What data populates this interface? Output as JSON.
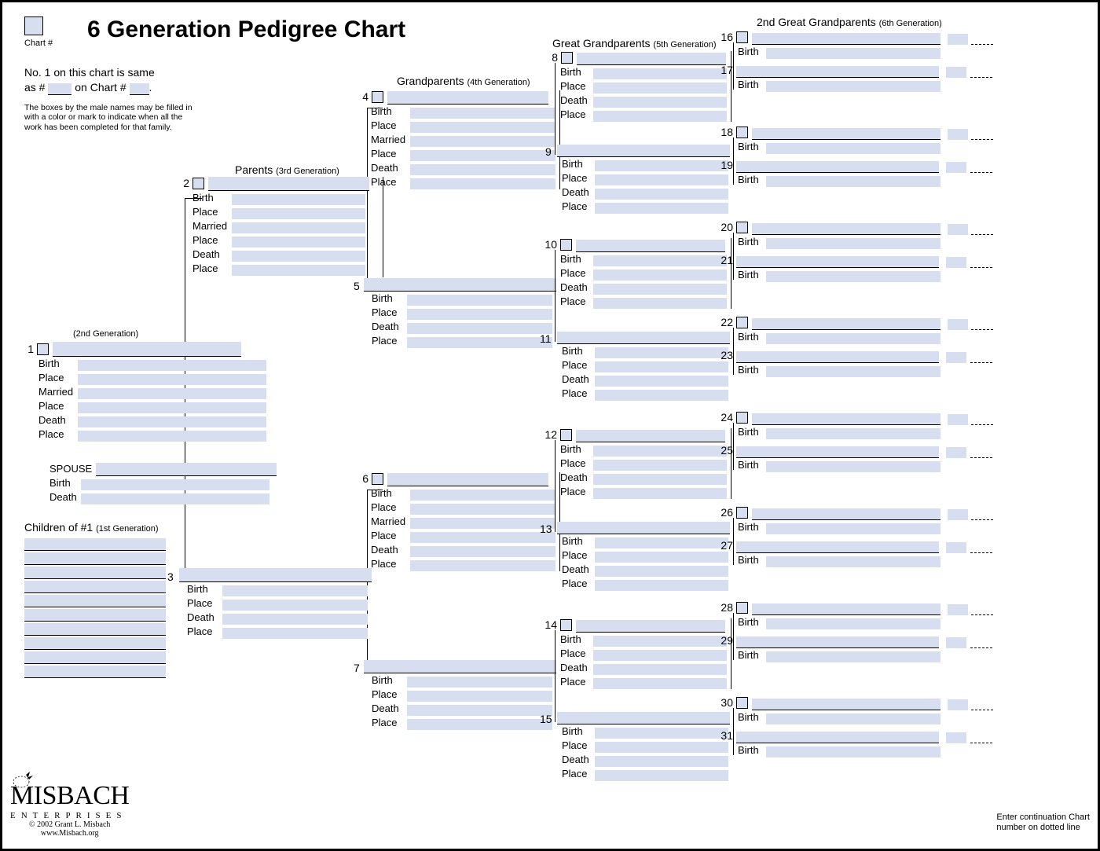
{
  "title": "6 Generation Pedigree Chart",
  "chartnum_label": "Chart #",
  "note_line1_a": "No. 1 on this chart is same",
  "note_line1_b": "as #",
  "note_line1_c": " on Chart #",
  "note_line1_d": ".",
  "note2": "The boxes by the male names may be filled in with a color or mark to indicate when all the work has been completed for that family.",
  "hdr_parents": "Parents",
  "hdr_parents_gen": "(3rd Generation)",
  "hdr_gp": "Grandparents",
  "hdr_gp_gen": "(4th Generation)",
  "hdr_ggp": "Great Grandparents",
  "hdr_ggp_gen": "(5th Generation)",
  "hdr_2ggp": "2nd Great Grandparents",
  "hdr_2ggp_gen": "(6th Generation)",
  "hdr_gen2": "(2nd Generation)",
  "hdr_spouse": "SPOUSE",
  "hdr_children_a": "Children of #1",
  "hdr_children_b": "(1st Generation)",
  "lbl_birth": "Birth",
  "lbl_place": "Place",
  "lbl_married": "Married",
  "lbl_death": "Death",
  "cont_note1": "Enter continuation Chart",
  "cont_note2": "number on dotted line",
  "logo_name": "MISBACH",
  "logo_ent": "ENTERPRISES",
  "copyright": "© 2002 Grant L. Misbach",
  "url": "www.Misbach.org",
  "n1": "1",
  "n2": "2",
  "n3": "3",
  "n4": "4",
  "n5": "5",
  "n6": "6",
  "n7": "7",
  "n8": "8",
  "n9": "9",
  "n10": "10",
  "n11": "11",
  "n12": "12",
  "n13": "13",
  "n14": "14",
  "n15": "15",
  "n16": "16",
  "n17": "17",
  "n18": "18",
  "n19": "19",
  "n20": "20",
  "n21": "21",
  "n22": "22",
  "n23": "23",
  "n24": "24",
  "n25": "25",
  "n26": "26",
  "n27": "27",
  "n28": "28",
  "n29": "29",
  "n30": "30",
  "n31": "31"
}
